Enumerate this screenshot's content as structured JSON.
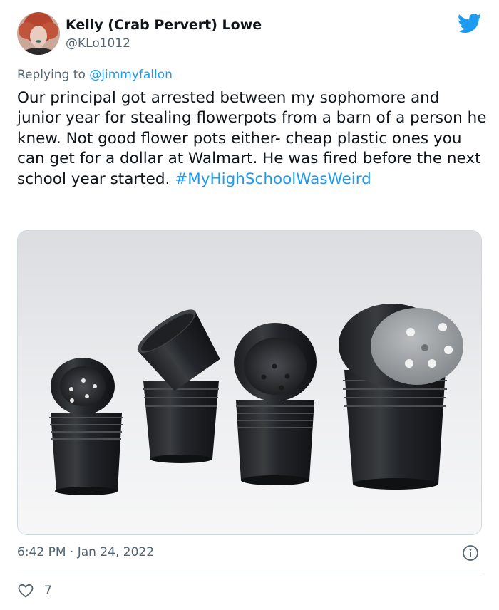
{
  "author": {
    "display_name": "Kelly (Crab Pervert) Lowe",
    "handle": "@KLo1012",
    "avatar_icon": "profile-photo"
  },
  "reply": {
    "prefix": "Replying to ",
    "mention": "@jimmyfallon"
  },
  "tweet": {
    "text": "Our principal got arrested between my sophomore and junior year for stealing flowerpots from a barn of a person he knew. Not good flower pots either- cheap plastic ones you can get for a dollar at Walmart. He was fired before the next school year started. ",
    "hashtag": "#MyHighSchoolWasWeird"
  },
  "meta": {
    "timestamp": "6:42 PM · Jan 24, 2022"
  },
  "engagement": {
    "likes": "7"
  },
  "colors": {
    "link": "#1d9bf0",
    "secondary_text": "#536471",
    "primary_text": "#0f1419",
    "twitter_blue": "#1d9bf0"
  }
}
